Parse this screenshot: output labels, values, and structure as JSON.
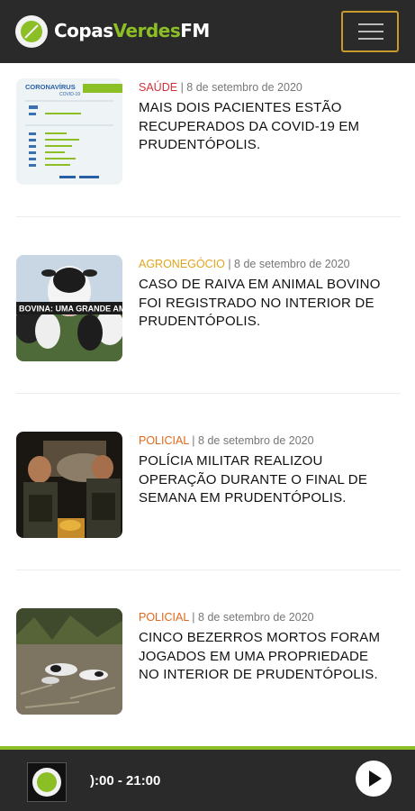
{
  "header": {
    "brand_prefix": "Copas",
    "brand_green": "Verdes",
    "brand_suffix": "FM",
    "menu_icon": "hamburger-icon"
  },
  "colors": {
    "accent_green": "#8cbf26",
    "bar_dark": "#2a2a2a",
    "menu_border": "#c79a2b",
    "cat_saude": "#d3303a",
    "cat_agronegocio": "#e0a51c",
    "cat_policial": "#e0681c"
  },
  "articles": [
    {
      "category": "SAÚDE",
      "date": "| 8 de setembro de 2020",
      "title": "MAIS DOIS PACIENTES ESTÃO RECUPERADOS DA COVID-19 EM PRUDENTÓPOLIS.",
      "thumb": {
        "heading": "CORONAVÍRUS",
        "sub": "COVID-19"
      }
    },
    {
      "category": "AGRONEGÓCIO",
      "date": "| 8 de setembro de 2020",
      "title": "CASO DE RAIVA EM ANIMAL BOVINO FOI REGISTRADO NO INTERIOR DE PRUDENTÓPOLIS.",
      "thumb": {
        "banner": "BOVINA: UMA GRANDE AM"
      }
    },
    {
      "category": "POLICIAL",
      "date": "| 8 de setembro de 2020",
      "title": "POLÍCIA MILITAR REALIZOU OPERAÇÃO DURANTE O FINAL DE SEMANA EM PRUDENTÓPOLIS."
    },
    {
      "category": "POLICIAL",
      "date": "| 8 de setembro de 2020",
      "title": "CINCO BEZERROS MORTOS FORAM JOGADOS EM UMA PROPRIEDADE NO INTERIOR DE PRUDENTÓPOLIS."
    }
  ],
  "player": {
    "schedule": "):00 - 21:00",
    "play_icon": "play-icon"
  }
}
